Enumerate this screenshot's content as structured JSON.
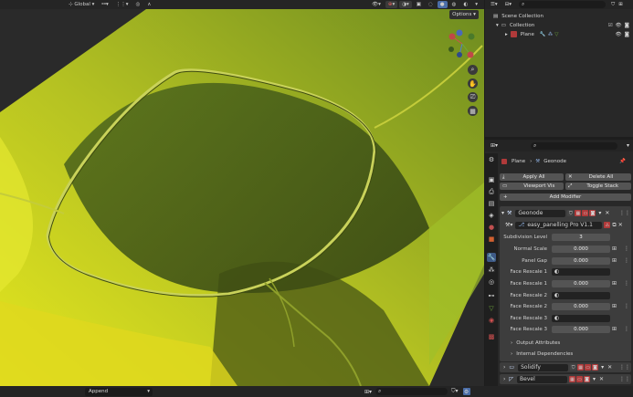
{
  "viewport_header": {
    "orientation": "Global",
    "options_label": "Options",
    "nav_icons": [
      "zoom-icon",
      "hand-icon",
      "camera-icon",
      "grid-icon"
    ]
  },
  "bottombar": {
    "append_label": "Append"
  },
  "outliner": {
    "scene_collection": "Scene Collection",
    "collection": "Collection",
    "plane": "Plane"
  },
  "properties": {
    "object_name": "Plane",
    "modifier_name_header": "Geonode",
    "apply_all": "Apply All",
    "delete_all": "Delete All",
    "viewport_vis": "Viewport Vis",
    "toggle_stack": "Toggle Stack",
    "add_modifier": "Add Modifier",
    "geonode_name": "Geonode",
    "node_group": "easy_panelling Pro V1.1",
    "params": [
      {
        "label": "Subdivision Level",
        "value": "3"
      },
      {
        "label": "Normal Scale",
        "value": "0.000"
      },
      {
        "label": "Panel Gap",
        "value": "0.000"
      },
      {
        "label": "Face Rescale 1",
        "value": ""
      },
      {
        "label": "Face Rescale 1",
        "value": "0.000"
      },
      {
        "label": "Face Rescale 2",
        "value": ""
      },
      {
        "label": "Face Rescale 2",
        "value": "0.000"
      },
      {
        "label": "Face Rescale 3",
        "value": ""
      },
      {
        "label": "Face Rescale 3",
        "value": "0.000"
      }
    ],
    "output_attributes": "Output Attributes",
    "internal_dependencies": "Internal Dependencies",
    "solidify": "Solidify",
    "bevel": "Bevel"
  },
  "colors": {
    "accent": "#4b6ea8",
    "modifier_red": "#b03a3a",
    "surface_yellow": "#d8dc2a",
    "surface_green": "#56731f"
  }
}
